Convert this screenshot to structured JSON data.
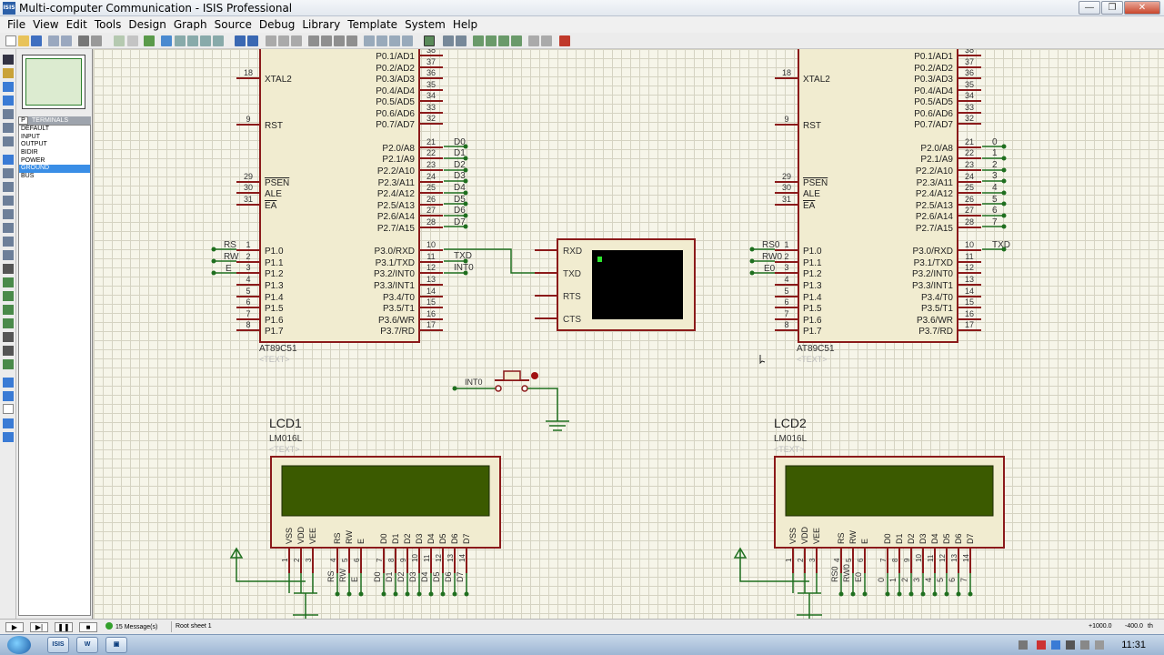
{
  "window": {
    "app_icon_label": "ISIS",
    "title": "Multi-computer Communication - ISIS Professional",
    "controls": [
      "—",
      "❐",
      "✕"
    ]
  },
  "menu": [
    "File",
    "View",
    "Edit",
    "Tools",
    "Design",
    "Graph",
    "Source",
    "Debug",
    "Library",
    "Template",
    "System",
    "Help"
  ],
  "panel": {
    "mode_letter": "P",
    "list_title": "TERMINALS",
    "items": [
      "DEFAULT",
      "INPUT",
      "OUTPUT",
      "BIDIR",
      "POWER",
      "GROUND",
      "BUS"
    ],
    "selected": "GROUND"
  },
  "schematic": {
    "mcu_left": {
      "part": "AT89C51",
      "text_placeholder": "<TEXT>",
      "left_pins": [
        {
          "num": "18",
          "name": "XTAL2"
        },
        {
          "num": "9",
          "name": "RST"
        },
        {
          "num": "29",
          "name": "PSEN"
        },
        {
          "num": "30",
          "name": "ALE"
        },
        {
          "num": "31",
          "name": "EA"
        },
        {
          "num": "1",
          "name": "P1.0",
          "net": "RS"
        },
        {
          "num": "2",
          "name": "P1.1",
          "net": "RW"
        },
        {
          "num": "3",
          "name": "P1.2",
          "net": "E"
        },
        {
          "num": "4",
          "name": "P1.3"
        },
        {
          "num": "5",
          "name": "P1.4"
        },
        {
          "num": "6",
          "name": "P1.5"
        },
        {
          "num": "7",
          "name": "P1.6"
        },
        {
          "num": "8",
          "name": "P1.7"
        }
      ],
      "right_pins": [
        {
          "num": "38",
          "name": "P0.1/AD1"
        },
        {
          "num": "37",
          "name": "P0.2/AD2"
        },
        {
          "num": "36",
          "name": "P0.3/AD3"
        },
        {
          "num": "35",
          "name": "P0.4/AD4"
        },
        {
          "num": "34",
          "name": "P0.5/AD5"
        },
        {
          "num": "33",
          "name": "P0.6/AD6"
        },
        {
          "num": "32",
          "name": "P0.7/AD7"
        },
        {
          "num": "21",
          "name": "P2.0/A8",
          "net": "D0"
        },
        {
          "num": "22",
          "name": "P2.1/A9",
          "net": "D1"
        },
        {
          "num": "23",
          "name": "P2.2/A10",
          "net": "D2"
        },
        {
          "num": "24",
          "name": "P2.3/A11",
          "net": "D3"
        },
        {
          "num": "25",
          "name": "P2.4/A12",
          "net": "D4"
        },
        {
          "num": "26",
          "name": "P2.5/A13",
          "net": "D5"
        },
        {
          "num": "27",
          "name": "P2.6/A14",
          "net": "D6"
        },
        {
          "num": "28",
          "name": "P2.7/A15",
          "net": "D7"
        },
        {
          "num": "10",
          "name": "P3.0/RXD"
        },
        {
          "num": "11",
          "name": "P3.1/TXD",
          "net": "TXD"
        },
        {
          "num": "12",
          "name": "P3.2/INT0",
          "net": "INT0"
        },
        {
          "num": "13",
          "name": "P3.3/INT1"
        },
        {
          "num": "14",
          "name": "P3.4/T0"
        },
        {
          "num": "15",
          "name": "P3.5/T1"
        },
        {
          "num": "16",
          "name": "P3.6/WR"
        },
        {
          "num": "17",
          "name": "P3.7/RD"
        }
      ]
    },
    "mcu_right": {
      "part": "AT89C51",
      "text_placeholder": "<TEXT>",
      "left_nets": [
        "RS0",
        "RW0",
        "E0"
      ],
      "right_nets": [
        "0",
        "1",
        "2",
        "3",
        "4",
        "5",
        "6",
        "7"
      ],
      "txd_net": "TXD"
    },
    "terminal": {
      "pins": [
        "RXD",
        "TXD",
        "RTS",
        "CTS"
      ]
    },
    "button_net": "INT0",
    "lcd1": {
      "ref": "LCD1",
      "part": "LM016L",
      "text_placeholder": "<TEXT>",
      "pin_labels": [
        "VSS",
        "VDD",
        "VEE",
        "RS",
        "RW",
        "E",
        "D0",
        "D1",
        "D2",
        "D3",
        "D4",
        "D5",
        "D6",
        "D7"
      ],
      "pin_numbers": [
        "1",
        "2",
        "3",
        "4",
        "5",
        "6",
        "7",
        "8",
        "9",
        "10",
        "11",
        "12",
        "13",
        "14"
      ],
      "net_labels": [
        "RS",
        "RW",
        "E",
        "D0",
        "D1",
        "D2",
        "D3",
        "D4",
        "D5",
        "D6",
        "D7"
      ]
    },
    "lcd2": {
      "ref": "LCD2",
      "part": "LM016L",
      "text_placeholder": "<TEXT>",
      "pin_labels": [
        "VSS",
        "VDD",
        "VEE",
        "RS",
        "RW",
        "E",
        "D0",
        "D1",
        "D2",
        "D3",
        "D4",
        "D5",
        "D6",
        "D7"
      ],
      "pin_numbers": [
        "1",
        "2",
        "3",
        "4",
        "5",
        "6",
        "7",
        "8",
        "9",
        "10",
        "11",
        "12",
        "13",
        "14"
      ],
      "net_labels": [
        "RS0",
        "RW0",
        "E0",
        "0",
        "1",
        "2",
        "3",
        "4",
        "5",
        "6",
        "7"
      ]
    }
  },
  "status": {
    "messages": "15 Message(s)",
    "sheet": "Root sheet 1",
    "coord_x": "+1000.0",
    "coord_y": "-400.0",
    "unit": "th"
  },
  "taskbar": {
    "items": [
      "ISIS",
      "W",
      "▣"
    ],
    "clock": "11:31"
  }
}
